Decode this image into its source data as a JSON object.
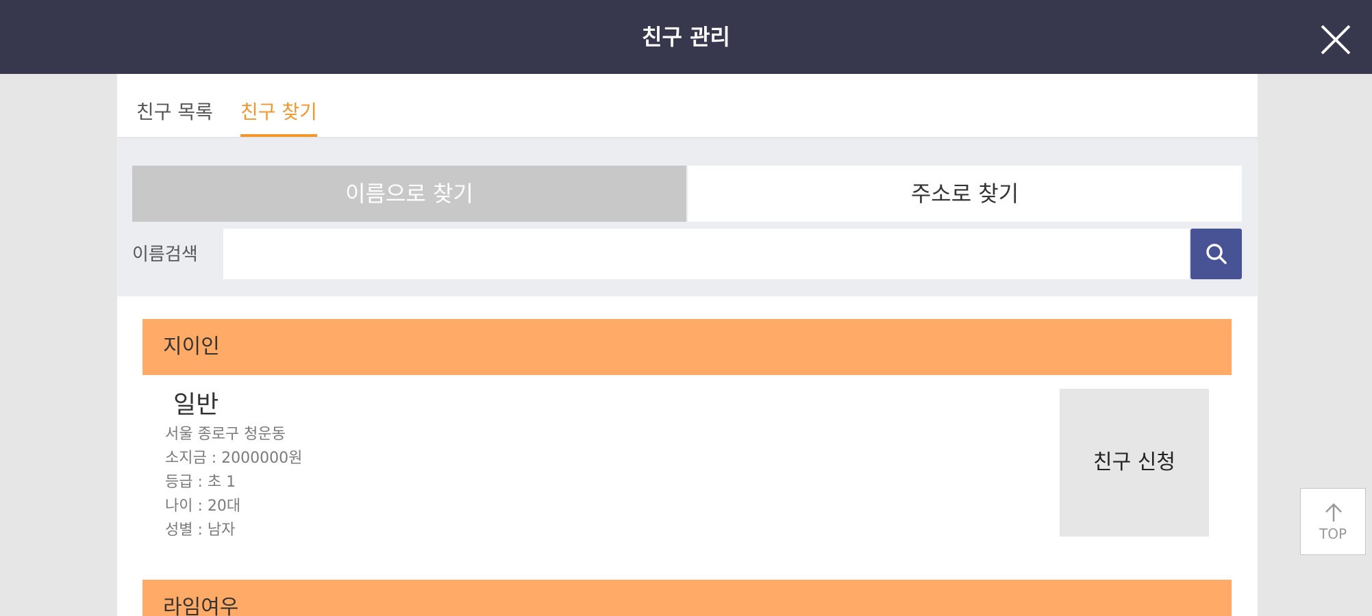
{
  "header": {
    "title": "친구 관리",
    "close_icon": "close-icon"
  },
  "tabs": [
    {
      "label": "친구 목록",
      "active": false
    },
    {
      "label": "친구 찾기",
      "active": true
    }
  ],
  "search": {
    "mode_buttons": [
      {
        "label": "이름으로 찾기",
        "active": true
      },
      {
        "label": "주소로 찾기",
        "active": false
      }
    ],
    "label": "이름검색",
    "value": "",
    "button_icon": "search-icon"
  },
  "results": [
    {
      "name": "지이인",
      "type": "일반",
      "address": "서울 종로구 청운동",
      "money": "소지금 : 2000000원",
      "grade": "등급 : 초 1",
      "age": "나이 : 20대",
      "gender": "성별 : 남자",
      "action_label": "친구 신청"
    },
    {
      "name": "라임여우"
    }
  ],
  "top_button": {
    "label": "TOP",
    "icon": "arrow-up-icon"
  },
  "colors": {
    "header_bg": "#37374d",
    "accent": "#f5962b",
    "result_header": "#ffab67",
    "search_button": "#475394"
  }
}
